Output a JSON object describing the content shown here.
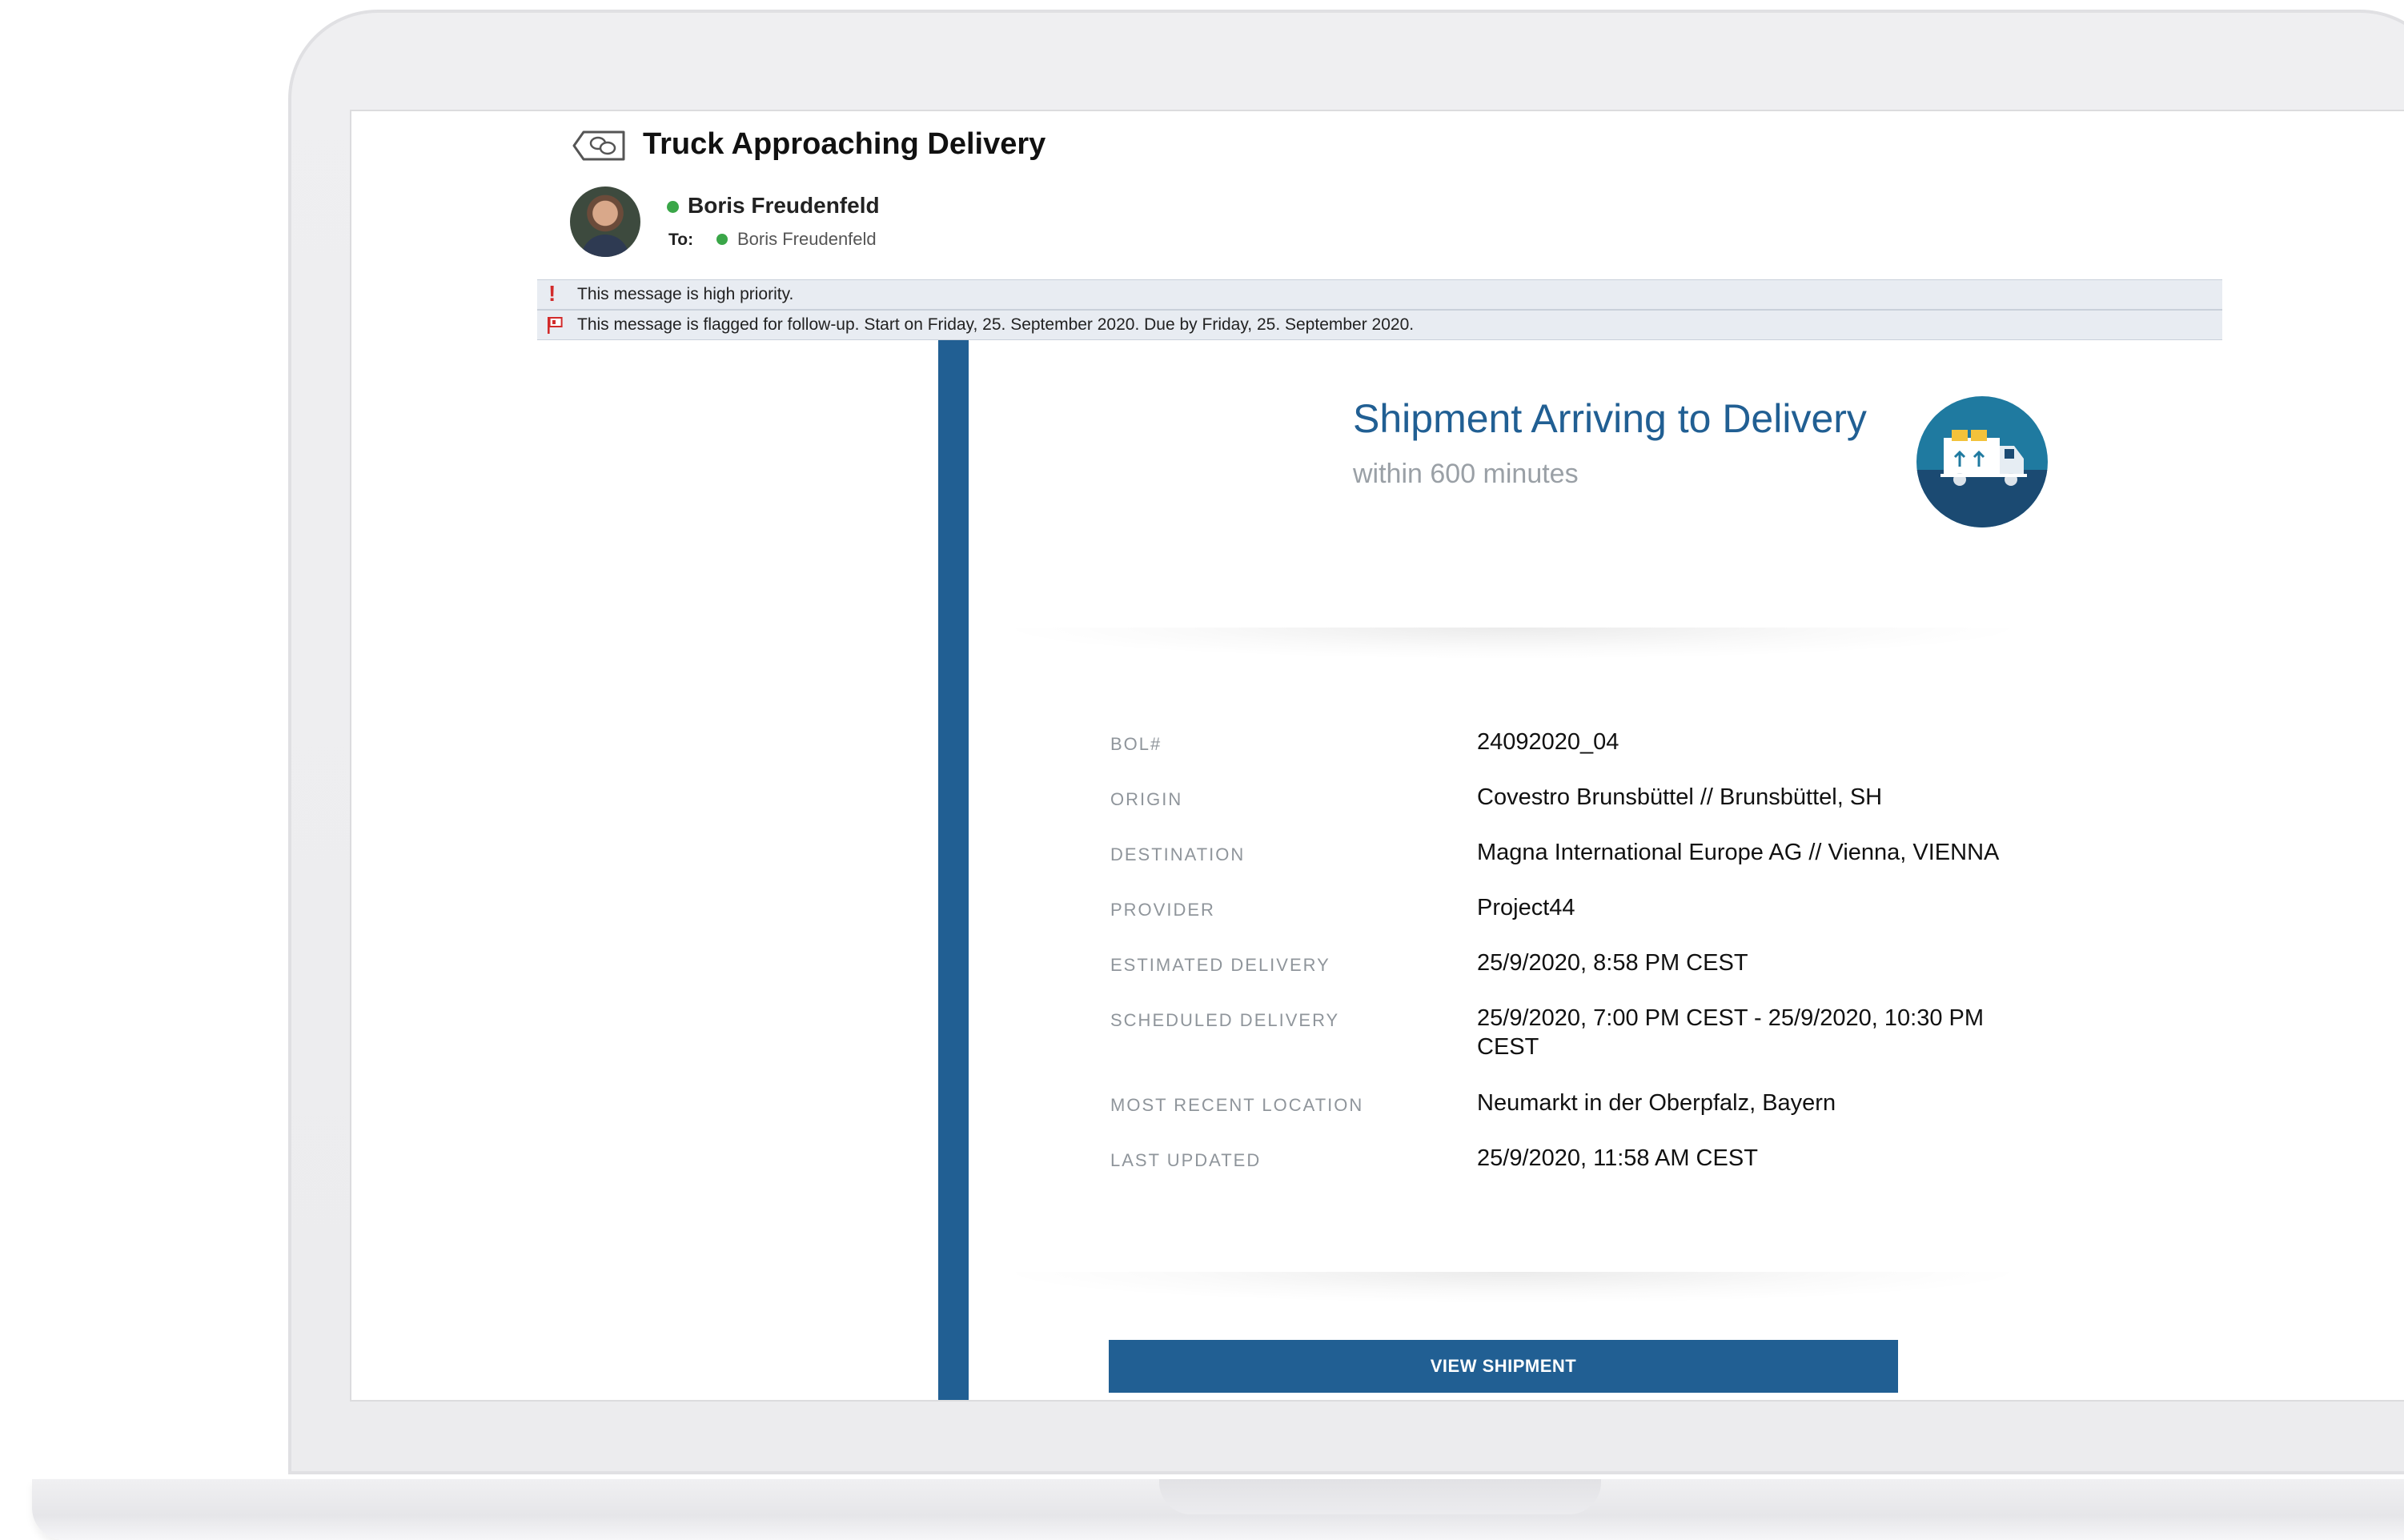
{
  "email": {
    "subject": "Truck Approaching Delivery",
    "sender": "Boris Freudenfeld",
    "to_label": "To:",
    "recipient": "Boris Freudenfeld",
    "banners": {
      "priority": "This message is high priority.",
      "flag": "This message is flagged for follow-up. Start on Friday, 25. September 2020.  Due by Friday, 25. September 2020."
    }
  },
  "body": {
    "title": "Shipment Arriving to Delivery",
    "subtitle": "within 600 minutes",
    "icon": "delivery-truck-icon",
    "details": [
      {
        "label": "BOL#",
        "value": "24092020_04"
      },
      {
        "label": "ORIGIN",
        "value": "Covestro Brunsbüttel // Brunsbüttel, SH"
      },
      {
        "label": "DESTINATION",
        "value": "Magna International Europe AG // Vienna, VIENNA"
      },
      {
        "label": "PROVIDER",
        "value": "Project44"
      },
      {
        "label": "ESTIMATED DELIVERY",
        "value": "25/9/2020, 8:58 PM CEST"
      },
      {
        "label": "SCHEDULED DELIVERY",
        "value": "25/9/2020, 7:00 PM CEST - 25/9/2020, 10:30 PM CEST"
      },
      {
        "label": "MOST RECENT LOCATION",
        "value": "Neumarkt in der Oberpfalz, Bayern"
      },
      {
        "label": "LAST UPDATED",
        "value": "25/9/2020, 11:58 AM CEST"
      }
    ],
    "button_label": "VIEW SHIPMENT"
  },
  "colors": {
    "brand_blue": "#215f93",
    "teal": "#1f7aa0",
    "online_green": "#3aa648",
    "priority_red": "#d22b2b"
  }
}
